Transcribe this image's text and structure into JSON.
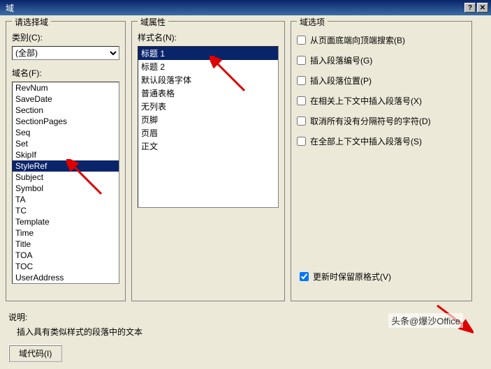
{
  "title": "域",
  "left": {
    "group_title": "请选择域",
    "category_label": "类别(C):",
    "category_value": "(全部)",
    "fieldname_label": "域名(F):",
    "fields": [
      "RevNum",
      "SaveDate",
      "Section",
      "SectionPages",
      "Seq",
      "Set",
      "SkipIf",
      "StyleRef",
      "Subject",
      "Symbol",
      "TA",
      "TC",
      "Template",
      "Time",
      "Title",
      "TOA",
      "TOC",
      "UserAddress"
    ],
    "selected_field": "StyleRef"
  },
  "middle": {
    "group_title": "域属性",
    "stylename_label": "样式名(N):",
    "styles": [
      "标题 1",
      "标题 2",
      "默认段落字体",
      "普通表格",
      "无列表",
      "页脚",
      "页眉",
      "正文"
    ],
    "selected_style": "标题 1"
  },
  "right": {
    "group_title": "域选项",
    "options": [
      "从页面底端向顶端搜索(B)",
      "插入段落编号(G)",
      "插入段落位置(P)",
      "在相关上下文中插入段落号(X)",
      "取消所有没有分隔符号的字符(D)",
      "在全部上下文中插入段落号(S)"
    ],
    "preserve_label": "更新时保留原格式(V)"
  },
  "desc_label": "说明:",
  "desc_text": "插入具有类似样式的段落中的文本",
  "btn_code": "域代码(I)",
  "watermark": "头条@爆沙Office"
}
